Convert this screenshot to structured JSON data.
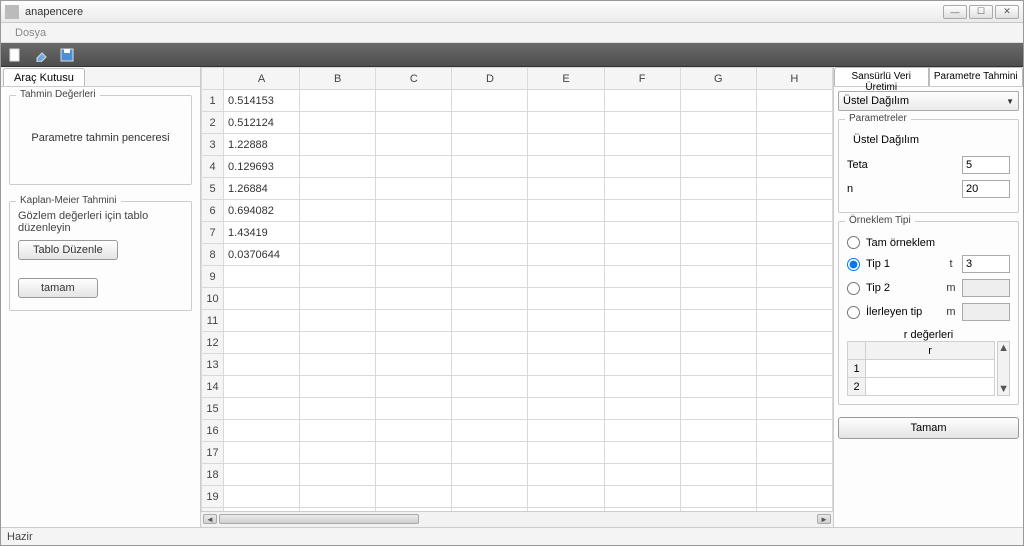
{
  "window": {
    "title": "anapencere"
  },
  "menu": {
    "file": "Dosya"
  },
  "left": {
    "tab": "Araç Kutusu",
    "group1": {
      "legend": "Tahmin Değerleri",
      "content": "Parametre tahmin penceresi"
    },
    "group2": {
      "legend": "Kaplan-Meier Tahmini",
      "hint": "Gözlem değerleri için tablo düzenleyin",
      "btn_edit": "Tablo Düzenle",
      "btn_ok": "tamam"
    }
  },
  "sheet": {
    "columns": [
      "A",
      "B",
      "C",
      "D",
      "E",
      "F",
      "G",
      "H"
    ],
    "rows": 20,
    "data": {
      "1": "0.514153",
      "2": "0.512124",
      "3": "1.22888",
      "4": "0.129693",
      "5": "1.26884",
      "6": "0.694082",
      "7": "1.43419",
      "8": "0.0370644"
    }
  },
  "right": {
    "tab1": "Sansürlü Veri Üretimi",
    "tab2": "Parametre Tahmini",
    "dist_selected": "Üstel Dağılım",
    "params": {
      "legend": "Parametreler",
      "title": "Üstel Dağılım",
      "teta_label": "Teta",
      "teta_value": "5",
      "n_label": "n",
      "n_value": "20"
    },
    "sample": {
      "legend": "Örneklem Tipi",
      "opt_full": "Tam örneklem",
      "opt_tip1": "Tip 1",
      "t_label": "t",
      "t_value": "3",
      "opt_tip2": "Tip 2",
      "m_label": "m",
      "opt_prog": "İlerleyen tip",
      "m2_label": "m",
      "r_title": "r değerleri",
      "r_col": "r",
      "r_rows": [
        "1",
        "2"
      ]
    },
    "btn_ok": "Tamam"
  },
  "status": {
    "text": "Hazir"
  }
}
